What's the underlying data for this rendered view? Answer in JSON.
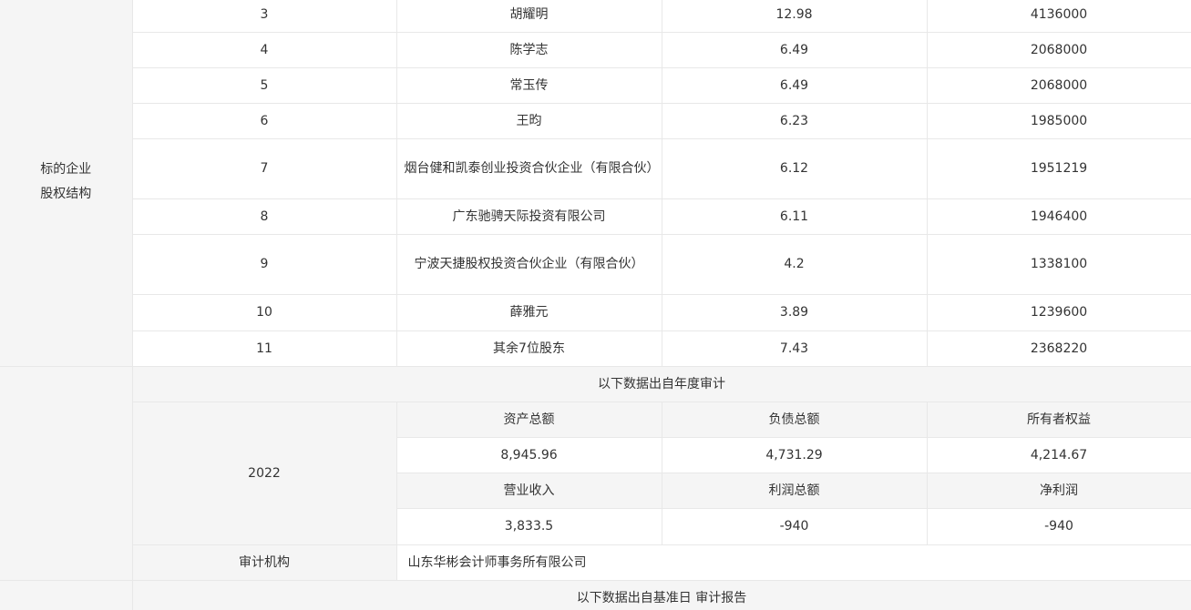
{
  "equity_structure": {
    "label_line1": "标的企业",
    "label_line2": "股权结构",
    "rows": [
      {
        "index": "3",
        "name": "胡耀明",
        "ratio": "12.98",
        "amount": "4136000"
      },
      {
        "index": "4",
        "name": "陈学志",
        "ratio": "6.49",
        "amount": "2068000"
      },
      {
        "index": "5",
        "name": "常玉传",
        "ratio": "6.49",
        "amount": "2068000"
      },
      {
        "index": "6",
        "name": "王昀",
        "ratio": "6.23",
        "amount": "1985000"
      },
      {
        "index": "7",
        "name": "烟台健和凯泰创业投资合伙企业（有限合伙）",
        "ratio": "6.12",
        "amount": "1951219"
      },
      {
        "index": "8",
        "name": "广东驰骋天际投资有限公司",
        "ratio": "6.11",
        "amount": "1946400"
      },
      {
        "index": "9",
        "name": "宁波天捷股权投资合伙企业（有限合伙）",
        "ratio": "4.2",
        "amount": "1338100"
      },
      {
        "index": "10",
        "name": "薛雅元",
        "ratio": "3.89",
        "amount": "1239600"
      },
      {
        "index": "11",
        "name": "其余7位股东",
        "ratio": "7.43",
        "amount": "2368220"
      }
    ]
  },
  "annual_audit": {
    "heading": "以下数据出自年度审计",
    "year": "2022",
    "headers_row1": [
      "资产总额",
      "负债总额",
      "所有者权益"
    ],
    "values_row1": [
      "8,945.96",
      "4,731.29",
      "4,214.67"
    ],
    "headers_row2": [
      "营业收入",
      "利润总额",
      "净利润"
    ],
    "values_row2": [
      "3,833.5",
      "-940",
      "-940"
    ],
    "auditor_label": "审计机构",
    "auditor_value": "山东华彬会计师事务所有限公司"
  },
  "base_date_audit": {
    "heading": "以下数据出自基准日 审计报告"
  }
}
